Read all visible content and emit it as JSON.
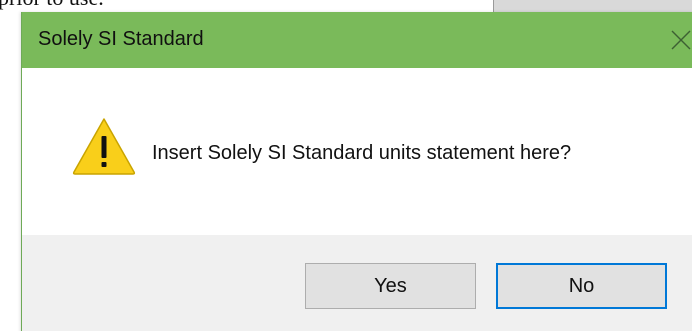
{
  "background": {
    "document_text": "prior to use."
  },
  "dialog": {
    "title": "Solely SI Standard",
    "message": "Insert Solely SI Standard units statement here?",
    "icon": "warning-icon",
    "buttons": {
      "yes_label": "Yes",
      "no_label": "No"
    },
    "colors": {
      "titlebar": "#7aba5a",
      "footer": "#f0f0f0",
      "focus_border": "#0078d7",
      "warning_fill": "#f9cf1a"
    }
  }
}
